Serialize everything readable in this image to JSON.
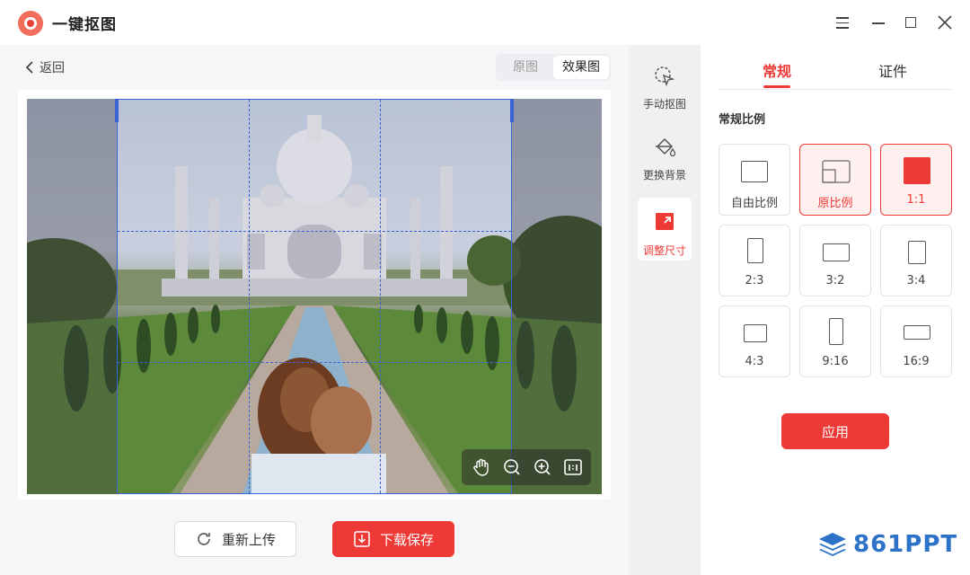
{
  "app": {
    "title": "一键抠图"
  },
  "window_controls": [
    "menu-icon",
    "minimize-icon",
    "maximize-icon",
    "close-icon"
  ],
  "nav": {
    "back_label": "返回"
  },
  "view_toggle": {
    "options": [
      "原图",
      "效果图"
    ],
    "selected": "效果图"
  },
  "editor": {
    "crop_ratio_shown": "1:1",
    "zoom_tools": [
      "hand-icon",
      "zoom-out-icon",
      "zoom-in-icon",
      "actual-size-icon"
    ]
  },
  "actions": {
    "reupload_label": "重新上传",
    "download_label": "下载保存"
  },
  "tools": [
    {
      "label": "手动抠图",
      "icon": "manual-cutout-icon",
      "active": false
    },
    {
      "label": "更换背景",
      "icon": "paint-bucket-icon",
      "active": false
    },
    {
      "label": "调整尺寸",
      "icon": "resize-icon",
      "active": true
    }
  ],
  "panel": {
    "tabs": [
      "常规",
      "证件"
    ],
    "active_tab": "常规",
    "section_title": "常规比例",
    "ratios": [
      {
        "label": "自由比例"
      },
      {
        "label": "原比例"
      },
      {
        "label": "1:1"
      },
      {
        "label": "2:3"
      },
      {
        "label": "3:2"
      },
      {
        "label": "3:4"
      },
      {
        "label": "4:3"
      },
      {
        "label": "9:16"
      },
      {
        "label": "16:9"
      }
    ],
    "selected_ratio": "1:1",
    "apply_label": "应用"
  },
  "watermark": {
    "text": "861PPT"
  },
  "colors": {
    "accent": "#ee3a36",
    "crop_line": "#3a63d6",
    "watermark": "#2c72c8"
  }
}
